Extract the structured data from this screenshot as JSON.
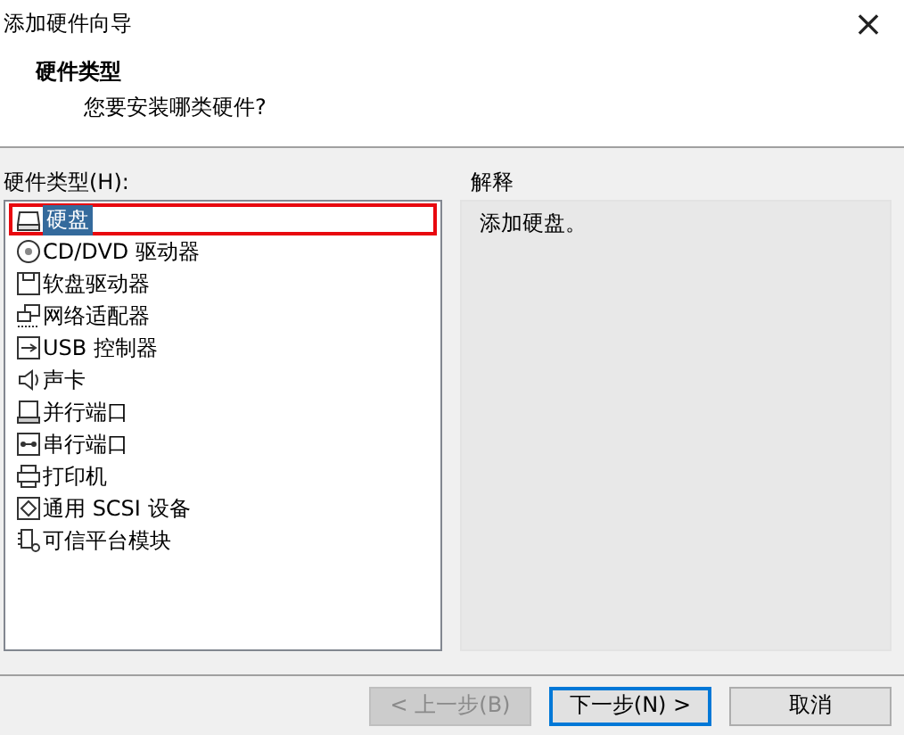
{
  "window": {
    "title": "添加硬件向导",
    "close": "×"
  },
  "header": {
    "title": "硬件类型",
    "subtitle": "您要安装哪类硬件?"
  },
  "list": {
    "label": "硬件类型(H):",
    "items": [
      {
        "label": "硬盘",
        "kind": "disk",
        "selected": true
      },
      {
        "label": "CD/DVD 驱动器",
        "kind": "cd",
        "selected": false
      },
      {
        "label": "软盘驱动器",
        "kind": "floppy",
        "selected": false
      },
      {
        "label": "网络适配器",
        "kind": "network",
        "selected": false
      },
      {
        "label": "USB 控制器",
        "kind": "usb",
        "selected": false
      },
      {
        "label": "声卡",
        "kind": "sound",
        "selected": false
      },
      {
        "label": "并行端口",
        "kind": "parallel",
        "selected": false
      },
      {
        "label": "串行端口",
        "kind": "serial",
        "selected": false
      },
      {
        "label": "打印机",
        "kind": "printer",
        "selected": false
      },
      {
        "label": "通用 SCSI 设备",
        "kind": "scsi",
        "selected": false
      },
      {
        "label": "可信平台模块",
        "kind": "tpm",
        "selected": false
      }
    ]
  },
  "explanation": {
    "label": "解释",
    "text": "添加硬盘。"
  },
  "buttons": [
    {
      "label": "< 上一步(B)",
      "disabled": true,
      "default": false
    },
    {
      "label": "下一步(N) >",
      "disabled": false,
      "default": true
    },
    {
      "label": "取消",
      "disabled": false,
      "default": false
    }
  ]
}
